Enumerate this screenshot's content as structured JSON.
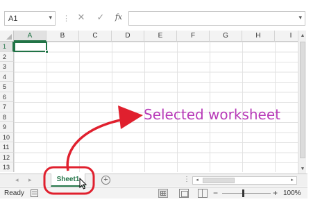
{
  "formula_bar": {
    "name_box": "A1",
    "name_box_caret": "▾",
    "separator": "⋮",
    "cancel": "✕",
    "enter": "✓",
    "function": "fx",
    "formula_value": "",
    "formula_caret": "▾"
  },
  "columns": [
    "A",
    "B",
    "C",
    "D",
    "E",
    "F",
    "G",
    "H",
    "I"
  ],
  "rows": [
    "1",
    "2",
    "3",
    "4",
    "5",
    "6",
    "7",
    "8",
    "9",
    "10",
    "11",
    "12",
    "13"
  ],
  "selection": {
    "column": "A",
    "row": "1"
  },
  "vscroll": {
    "up": "▲",
    "down": "▼"
  },
  "tab_bar": {
    "prev": "◂",
    "next": "▸",
    "sheet_name": "Sheet1",
    "add_sheet": "+",
    "dots": "⋮",
    "hscroll_left": "◂",
    "hscroll_right": "▸"
  },
  "status_bar": {
    "status": "Ready",
    "zoom_minus": "−",
    "zoom_plus": "+",
    "zoom": "100%"
  },
  "annotation": {
    "text": "Selected worksheet",
    "color": "#b83bb8",
    "arrow_color": "#e0202e"
  },
  "colors": {
    "accent": "#217346"
  }
}
